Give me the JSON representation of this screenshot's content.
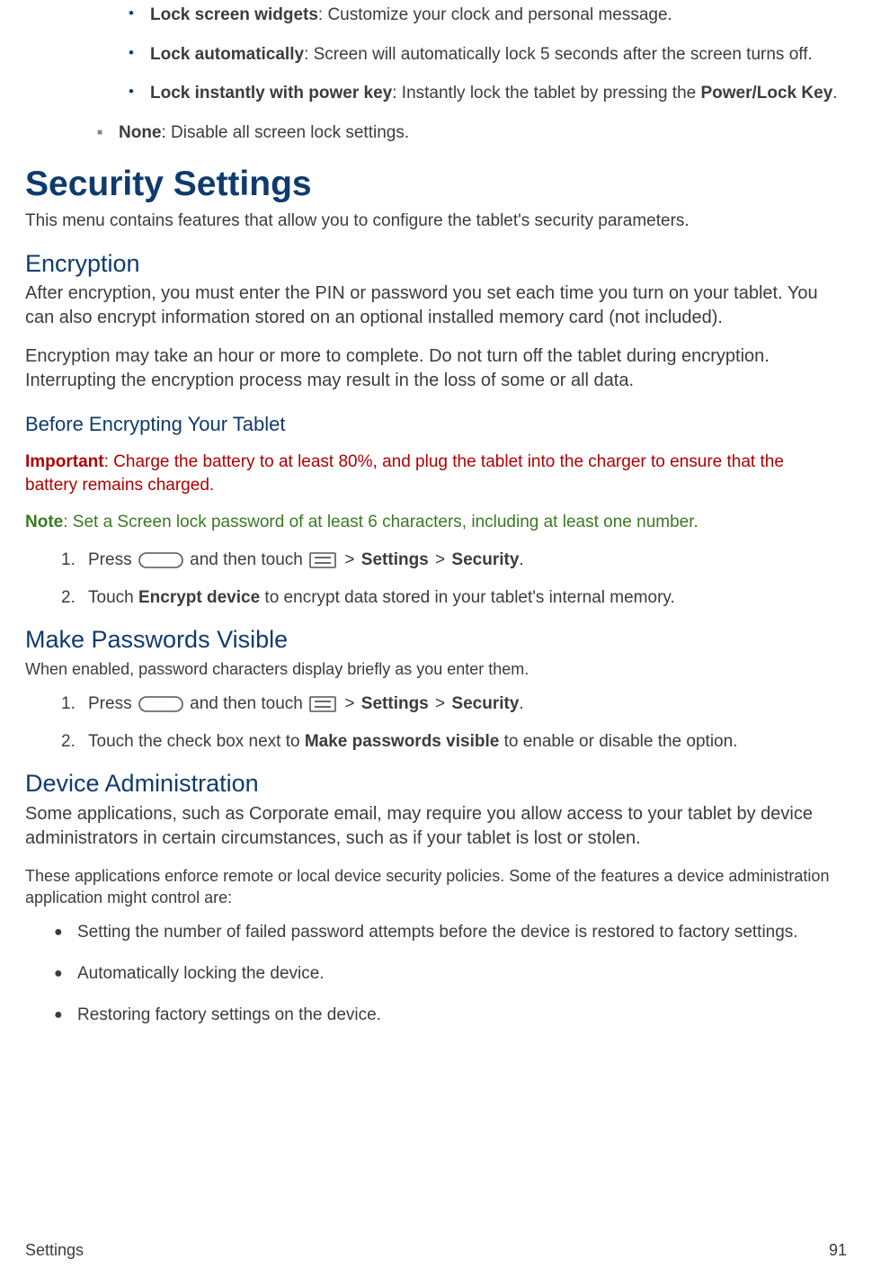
{
  "subBullets": [
    {
      "label": "Lock screen widgets",
      "rest": ": Customize your clock and personal message."
    },
    {
      "label": "Lock automatically",
      "rest": ": Screen will automatically lock 5 seconds after the screen turns off."
    },
    {
      "label": "Lock instantly with power key",
      "prefix": ": Instantly lock the tablet by pressing the ",
      "boldTail": "Power/Lock Key",
      "suffix": "."
    }
  ],
  "squareItem": {
    "label": "None",
    "rest": ": Disable all screen lock settings."
  },
  "h1": "Security Settings",
  "intro": "This menu contains features that allow you to configure the tablet's security parameters.",
  "encryption": {
    "heading": "Encryption",
    "p1": "After encryption, you must enter the PIN or password you set each time you turn on your tablet. You can also encrypt information stored on an optional installed memory card (not included).",
    "p2": "Encryption may take an hour or more to complete. Do not turn off the tablet during encryption. Interrupting the encryption process may result in the loss of some or all data.",
    "h3": "Before Encrypting Your Tablet",
    "importantLabel": "Important",
    "importantText": ": Charge the battery to at least 80%, and plug the tablet into the charger to ensure that the battery remains charged.",
    "noteLabel": "Note",
    "noteText": ": Set a Screen lock password of at least 6 characters, including at least one number.",
    "step1_pre": "Press ",
    "step1_mid": " and then touch ",
    "nav_sep": " > ",
    "nav_settings": "Settings",
    "nav_security": "Security",
    "period": ".",
    "step2_pre": "Touch ",
    "step2_bold": "Encrypt device",
    "step2_rest": " to encrypt data stored in your tablet's internal memory."
  },
  "passwords": {
    "heading": "Make Passwords Visible",
    "p": "When enabled, password characters display briefly as you enter them.",
    "step1_pre": "Press ",
    "step1_mid": " and then touch ",
    "step2_pre": "Touch the check box next to ",
    "step2_bold": "Make passwords visible",
    "step2_rest": " to enable or disable the option."
  },
  "deviceAdmin": {
    "heading": "Device Administration",
    "p1": "Some applications, such as Corporate email, may require you allow access to your tablet by device administrators in certain circumstances, such as if your tablet is lost or stolen.",
    "p2": "These applications enforce remote or local device security policies. Some of the features a device administration application might control are:",
    "bullets": [
      "Setting the number of failed password attempts before the device is restored to factory settings.",
      "Automatically locking the device.",
      "Restoring factory settings on the device."
    ]
  },
  "ol_numbers": {
    "n1": "1.",
    "n2": "2."
  },
  "footer": {
    "section": "Settings",
    "page": "91"
  }
}
